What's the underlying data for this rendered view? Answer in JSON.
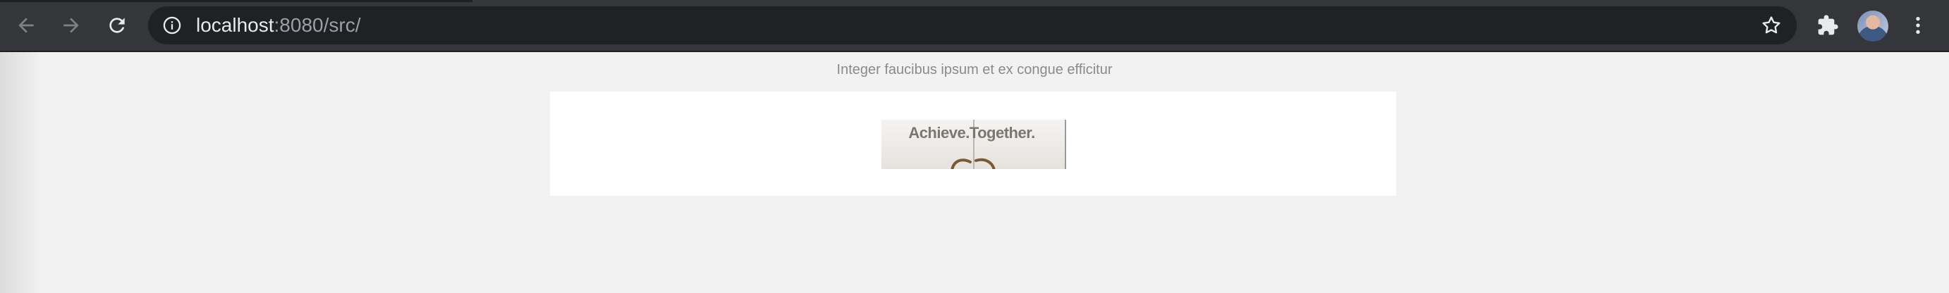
{
  "browser": {
    "url_host": "localhost",
    "url_rest": ":8080/src/",
    "icons": {
      "back": "arrow-left-icon",
      "forward": "arrow-right-icon",
      "reload": "reload-icon",
      "site_info": "info-icon",
      "bookmark": "star-icon",
      "extensions": "puzzle-icon",
      "profile": "avatar",
      "menu": "kebab-menu-icon"
    }
  },
  "page": {
    "caption": "Integer faucibus ipsum et ex congue efficitur",
    "banner_text": "Achieve.Together."
  },
  "colors": {
    "toolbar_bg": "#35363a",
    "omnibox_bg": "#202124",
    "page_bg": "#f2f2f2",
    "card_bg": "#ffffff"
  }
}
